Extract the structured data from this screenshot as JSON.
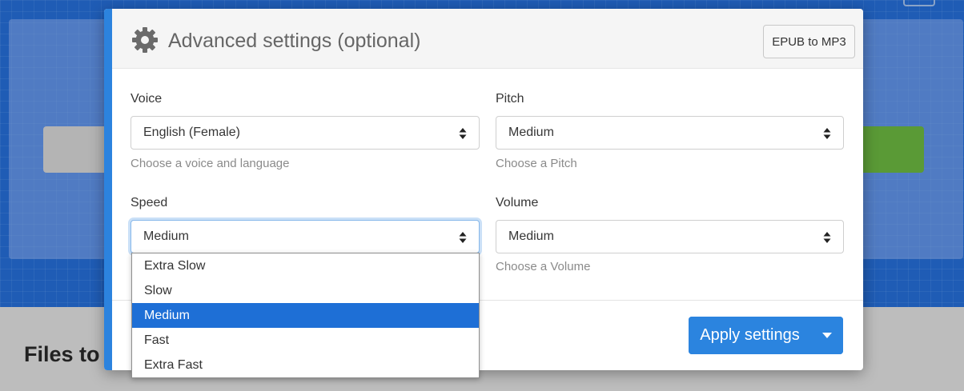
{
  "background": {
    "files_heading": "Files to"
  },
  "modal": {
    "title": "Advanced settings (optional)",
    "header_button": "EPUB to MP3",
    "voice": {
      "label": "Voice",
      "value": "English (Female)",
      "help": "Choose a voice and language"
    },
    "pitch": {
      "label": "Pitch",
      "value": "Medium",
      "help": "Choose a Pitch"
    },
    "speed": {
      "label": "Speed",
      "value": "Medium",
      "options": [
        "Extra Slow",
        "Slow",
        "Medium",
        "Fast",
        "Extra Fast"
      ],
      "selected_option": "Medium"
    },
    "volume": {
      "label": "Volume",
      "value": "Medium",
      "help": "Choose a Volume"
    },
    "apply_button": "Apply settings"
  },
  "colors": {
    "accent": "#2c83de",
    "apply_button": "#2b84df",
    "selected_option": "#1e6fd6",
    "page_background": "#1f5cb5"
  },
  "icons": {
    "header": "gear-icon",
    "select": "sort-arrows-icon",
    "apply_dropdown": "caret-down-icon"
  }
}
